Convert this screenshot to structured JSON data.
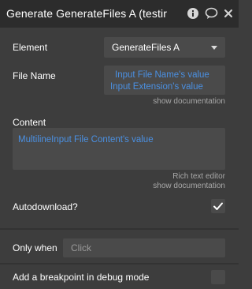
{
  "header": {
    "title": "Generate GenerateFiles A (testir",
    "icons": [
      "info-icon",
      "comment-icon",
      "close-icon"
    ]
  },
  "element_field": {
    "label": "Element",
    "value": "GenerateFiles A"
  },
  "file_name_field": {
    "label": "File Name",
    "line1": "Input File Name's value",
    "line2": "Input Extension's value",
    "hint": "show documentation"
  },
  "content_field": {
    "label": "Content",
    "value": "MultilineInput File Content's value",
    "hint1": "Rich text editor",
    "hint2": "show documentation"
  },
  "autodownload_field": {
    "label": "Autodownload?",
    "checked": true
  },
  "only_when_field": {
    "label": "Only when",
    "placeholder": "Click"
  },
  "breakpoint_field": {
    "label": "Add a breakpoint in debug mode",
    "checked": false
  },
  "colors": {
    "panel_bg": "#3d3d3d",
    "header_bg": "#2c2c2c",
    "field_bg": "#4a4a4a",
    "dynamic_text": "#4a90e2",
    "hint_text": "#a8a8a8"
  }
}
